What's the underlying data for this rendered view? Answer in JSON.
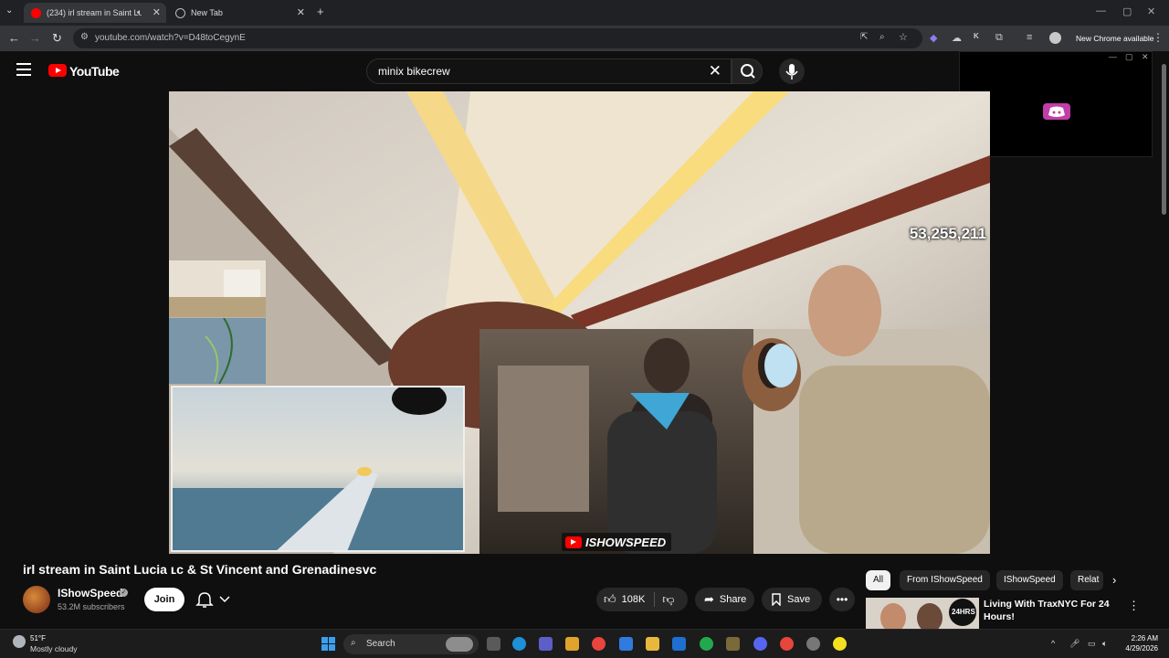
{
  "browser": {
    "tabs": [
      {
        "title": "(234) irl stream in Saint Luc",
        "favicon": "youtube-icon",
        "active": true,
        "audio": true
      },
      {
        "title": "New Tab",
        "favicon": "globe-icon",
        "active": false
      }
    ],
    "url": "youtube.com/watch?v=D48toCegynE",
    "profile_label": "New Chrome available"
  },
  "youtube": {
    "logo_text": "YouTube",
    "search_query": "minix bikecrew"
  },
  "video": {
    "viewer_count": "53,255,211",
    "watermark": "ISHOWSPEED",
    "title": "irl stream in Saint Lucia ʟᴄ & St Vincent and Grenadinesvc"
  },
  "channel": {
    "name": "IShowSpeed",
    "subscribers": "53.2M subscribers",
    "join_label": "Join"
  },
  "actions": {
    "likes": "108K",
    "share_label": "Share",
    "save_label": "Save"
  },
  "chips": [
    "All",
    "From IShowSpeed",
    "IShowSpeed",
    "Relat"
  ],
  "recommendation": {
    "title": "Living With TraxNYC For 24 Hours!",
    "thumb_badge": "24HRS"
  },
  "taskbar": {
    "temperature": "51°F",
    "weather": "Mostly cloudy",
    "search_label": "Search",
    "time": "2:26 AM",
    "date": "4/29/2026"
  },
  "colors": {
    "youtube_red": "#ff0000",
    "page_bg": "#0f0f0f",
    "discord_pink": "#c13ea8"
  }
}
